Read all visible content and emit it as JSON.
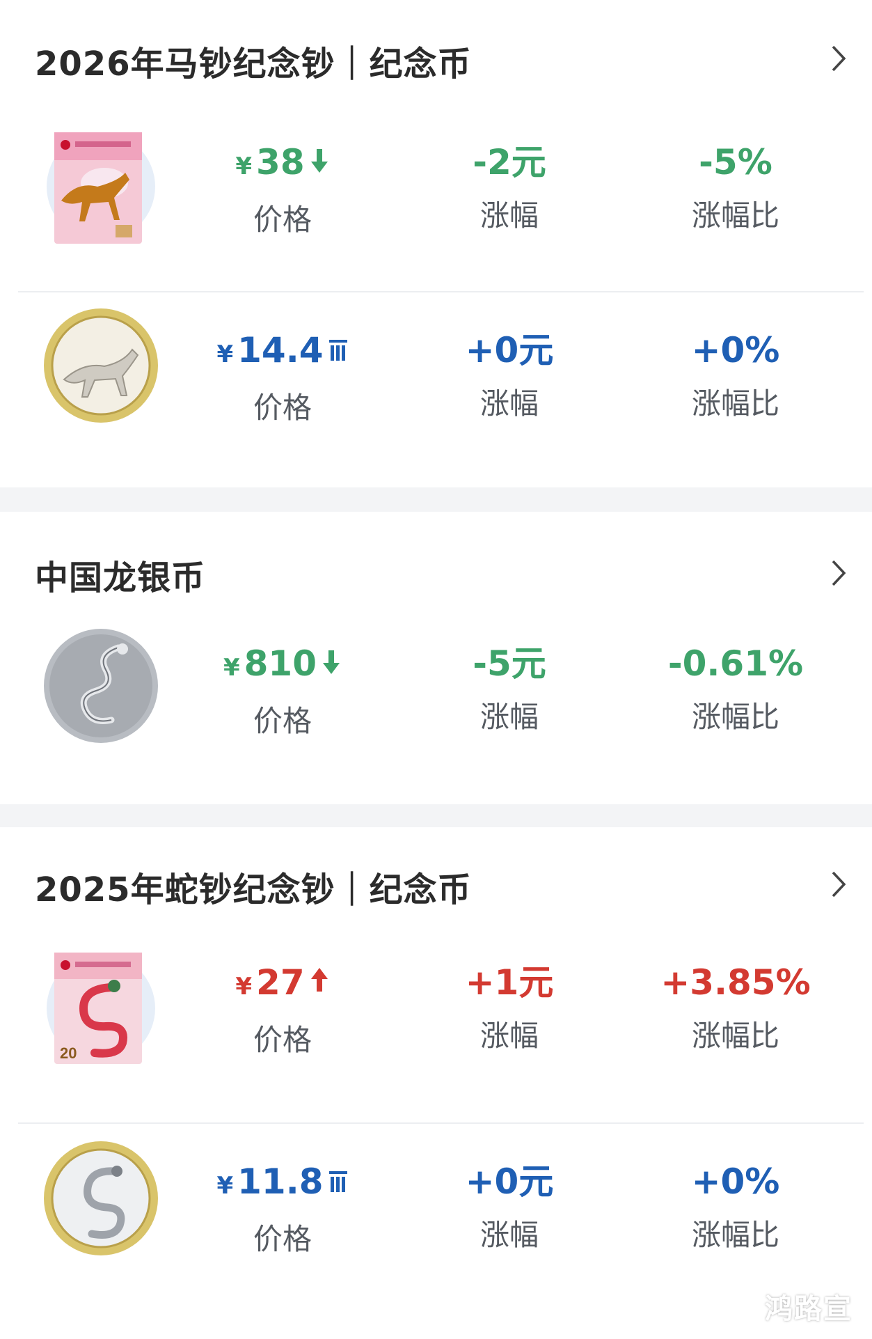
{
  "sections": [
    {
      "title": "2026年马钞纪念钞｜纪念币",
      "items": [
        {
          "price": "38",
          "trend": "down",
          "change": "-2元",
          "pct": "-5%",
          "thumb": "horse-banknote"
        },
        {
          "price": "14.4",
          "trend": "flat",
          "change": "+0元",
          "pct": "+0%",
          "thumb": "horse-coin"
        }
      ]
    },
    {
      "title": "中国龙银币",
      "items": [
        {
          "price": "810",
          "trend": "down",
          "change": "-5元",
          "pct": "-0.61%",
          "thumb": "dragon-silver-coin"
        }
      ]
    },
    {
      "title": "2025年蛇钞纪念钞｜纪念币",
      "items": [
        {
          "price": "27",
          "trend": "up",
          "change": "+1元",
          "pct": "+3.85%",
          "thumb": "snake-banknote"
        },
        {
          "price": "11.8",
          "trend": "flat",
          "change": "+0元",
          "pct": "+0%",
          "thumb": "snake-coin"
        }
      ]
    }
  ],
  "labels": {
    "yen": "¥",
    "price": "价格",
    "change": "涨幅",
    "pct": "涨幅比"
  },
  "icons": {
    "chevron": "chevron-right-icon",
    "down": "arrow-down-icon",
    "up": "arrow-up-icon",
    "flat": "flat-bars-icon"
  },
  "colors": {
    "down": "#3ea36a",
    "up": "#d33a31",
    "flat": "#1f5fb4"
  },
  "watermark": "鸿路宣"
}
